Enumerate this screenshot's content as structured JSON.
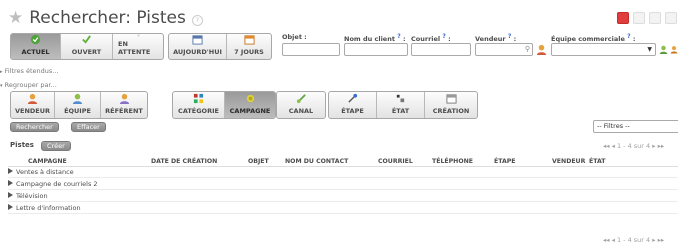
{
  "header": {
    "title": "Rechercher: Pistes",
    "view_switch": [
      "list-view-icon",
      "form-view-icon",
      "graph-view-icon",
      "calendar-view-icon",
      "gantt-view-icon"
    ]
  },
  "status_filters": [
    "ACTUEL",
    "OUVERT",
    "EN ATTENTE"
  ],
  "date_filters": [
    "AUJOURD'HUI",
    "7 JOURS"
  ],
  "search_fields": {
    "objet": "Objet :",
    "nom_client": "Nom du client",
    "courriel": "Courriel",
    "vendeur": "Vendeur",
    "equipe": "Équipe commerciale",
    "help_mark": "?",
    "colon": ":"
  },
  "filters": {
    "extended": "Filtres étendus...",
    "group_by": "Regrouper par..."
  },
  "group_buttons_1": [
    "VENDEUR",
    "ÉQUIPE",
    "RÉFÉRENT"
  ],
  "group_buttons_2": [
    "CATÉGORIE",
    "CAMPAGNE",
    "CANAL",
    "ÉTAPE",
    "ÉTAT",
    "CRÉATION"
  ],
  "actions": {
    "search": "Rechercher",
    "clear": "Effacer",
    "filters_select": "-- Filtres --"
  },
  "list": {
    "title": "Pistes",
    "create": "Créer",
    "pager": "1 - 4 sur 4",
    "columns": [
      "CAMPAGNE",
      "DATE DE CRÉATION",
      "OBJET",
      "NOM DU CONTACT",
      "COURRIEL",
      "TÉLÉPHONE",
      "ÉTAPE",
      "VENDEUR",
      "ÉTAT"
    ],
    "groups": [
      "Ventes à distance",
      "Campagne de courriels 2",
      "Télévision",
      "Lettre d'information"
    ]
  },
  "colors": {
    "accent_red": "#e23d3d",
    "help_blue": "#3a6ccf",
    "selected_btn": "#a3a3a3"
  }
}
